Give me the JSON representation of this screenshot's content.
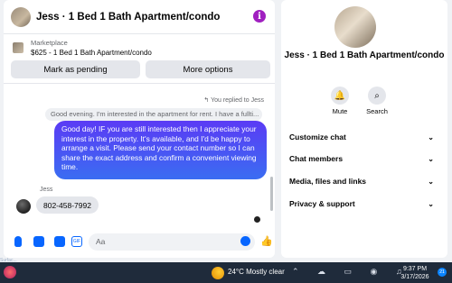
{
  "conversation": {
    "title": "Jess · 1 Bed 1 Bath Apartment/condo",
    "info_icon": "info-icon",
    "listing_label": "Marketplace",
    "listing_detail": "$625 - 1 Bed 1 Bath Apartment/condo",
    "mark_pending_label": "Mark as pending",
    "more_options_label": "More options"
  },
  "messages": {
    "replied_note": "You replied to Jess",
    "quoted_text": "Good evening.  I'm interested in the apartment for rent. I have a fullti...",
    "outgoing_text": "Good day! IF you are still interested then I appreciate your interest in the property. It's available, and I'd be happy to arrange a visit. Please send your contact number so I can share the exact address and confirm a convenient viewing time.",
    "sender_name": "Jess",
    "incoming_text": "802-458-7992"
  },
  "composer": {
    "placeholder": "Aa",
    "gif_label": "GIF"
  },
  "details": {
    "title": "Jess · 1 Bed 1 Bath Apartment/condo",
    "mute_label": "Mute",
    "search_label": "Search",
    "sections": [
      "Customize chat",
      "Chat members",
      "Media, files and links",
      "Privacy & support"
    ]
  },
  "taskbar": {
    "surface_label": "Surfac...",
    "weather": "24°C  Mostly clear",
    "time": "9:37 PM",
    "date": "3/17/2026",
    "notification_count": "21"
  },
  "colors": {
    "accent": "#0866ff",
    "bubble_start": "#5b3bf5",
    "bubble_end": "#3a6df2",
    "info": "#a020c0"
  }
}
